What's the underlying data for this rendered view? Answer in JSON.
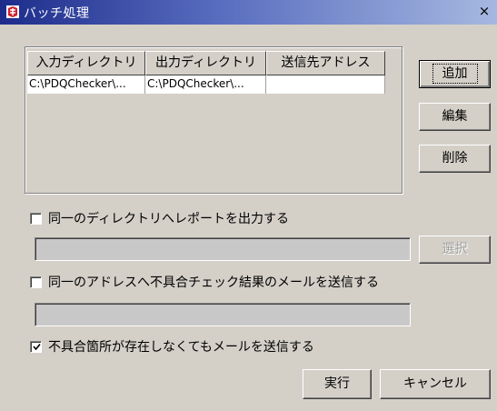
{
  "window": {
    "title": "バッチ処理",
    "close_label": "×"
  },
  "table": {
    "headers": [
      "入力ディレクトリ",
      "出力ディレクトリ",
      "送信先アドレス"
    ],
    "rows": [
      [
        "C:\\PDQChecker\\...",
        "C:\\PDQChecker\\...",
        ""
      ]
    ]
  },
  "buttons": {
    "add": "追加",
    "edit": "編集",
    "delete": "削除",
    "select": "選択",
    "run": "実行",
    "cancel": "キャンセル"
  },
  "options": {
    "same_dir": {
      "label": "同一のディレクトリへレポートを出力する",
      "checked": false
    },
    "same_dir_path": "",
    "same_addr": {
      "label": "同一のアドレスへ不具合チェック結果のメールを送信する",
      "checked": false
    },
    "same_addr_value": "",
    "send_always": {
      "label": "不具合箇所が存在しなくてもメールを送信する",
      "checked": true
    }
  }
}
